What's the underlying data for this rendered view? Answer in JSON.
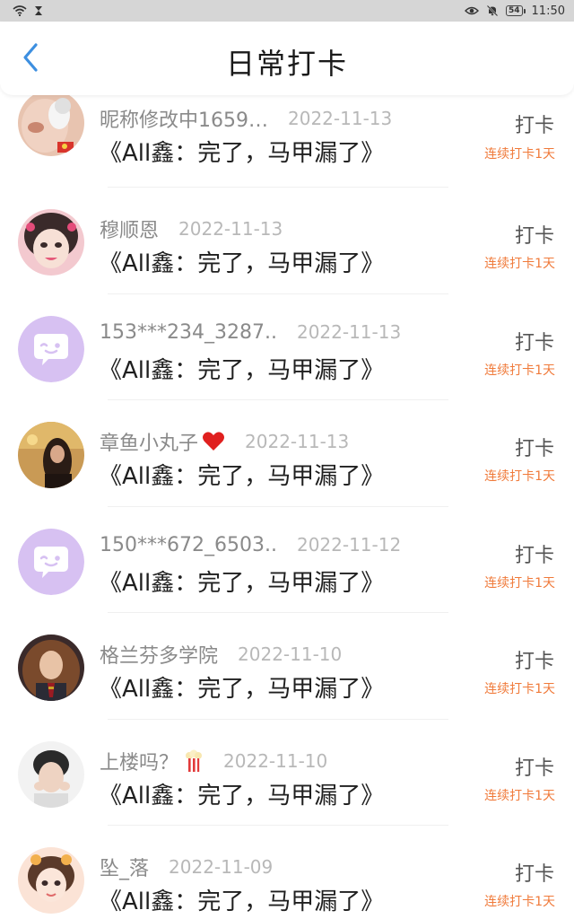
{
  "status_bar": {
    "time": "11:50",
    "battery": "54",
    "left_icons": [
      "wifi-icon",
      "hourglass-icon"
    ],
    "right_icons": [
      "eye-icon",
      "mute-bell-icon",
      "battery-icon"
    ]
  },
  "header": {
    "title": "日常打卡",
    "back_icon": "chevron-left-icon",
    "accent_color": "#3d8fe0"
  },
  "colors": {
    "streak": "#f07a3a",
    "avatar_placeholder": "#d7c1f2"
  },
  "entries": [
    {
      "username": "昵称修改中1659…",
      "date": "2022-11-13",
      "book": "《All鑫：完了，马甲漏了》",
      "action": "打卡",
      "streak": "连续打卡1天",
      "avatar": "photo-face-avatar"
    },
    {
      "username": "穆顺恩",
      "date": "2022-11-13",
      "book": "《All鑫：完了，马甲漏了》",
      "action": "打卡",
      "streak": "连续打卡1天",
      "avatar": "anime-girl-avatar"
    },
    {
      "username": "153***234_3287..",
      "date": "2022-11-13",
      "book": "《All鑫：完了，马甲漏了》",
      "action": "打卡",
      "streak": "连续打卡1天",
      "avatar": "default-chat-avatar"
    },
    {
      "username": "章鱼小丸子",
      "date": "2022-11-13",
      "book": "《All鑫：完了，马甲漏了》",
      "action": "打卡",
      "streak": "连续打卡1天",
      "avatar": "photo-girl-avatar",
      "emoji": "heart-icon"
    },
    {
      "username": "150***672_6503..",
      "date": "2022-11-12",
      "book": "《All鑫：完了，马甲漏了》",
      "action": "打卡",
      "streak": "连续打卡1天",
      "avatar": "default-chat-avatar"
    },
    {
      "username": "格兰芬多学院",
      "date": "2022-11-10",
      "book": "《All鑫：完了，马甲漏了》",
      "action": "打卡",
      "streak": "连续打卡1天",
      "avatar": "photo-hermione-avatar"
    },
    {
      "username": "上楼吗？",
      "date": "2022-11-10",
      "book": "《All鑫：完了，马甲漏了》",
      "action": "打卡",
      "streak": "连续打卡1天",
      "avatar": "photo-boy-avatar",
      "emoji": "popcorn-icon"
    },
    {
      "username": "坠_落",
      "date": "2022-11-09",
      "book": "《All鑫：完了，马甲漏了》",
      "action": "打卡",
      "streak": "连续打卡1天",
      "avatar": "illustrated-girl-avatar"
    }
  ]
}
